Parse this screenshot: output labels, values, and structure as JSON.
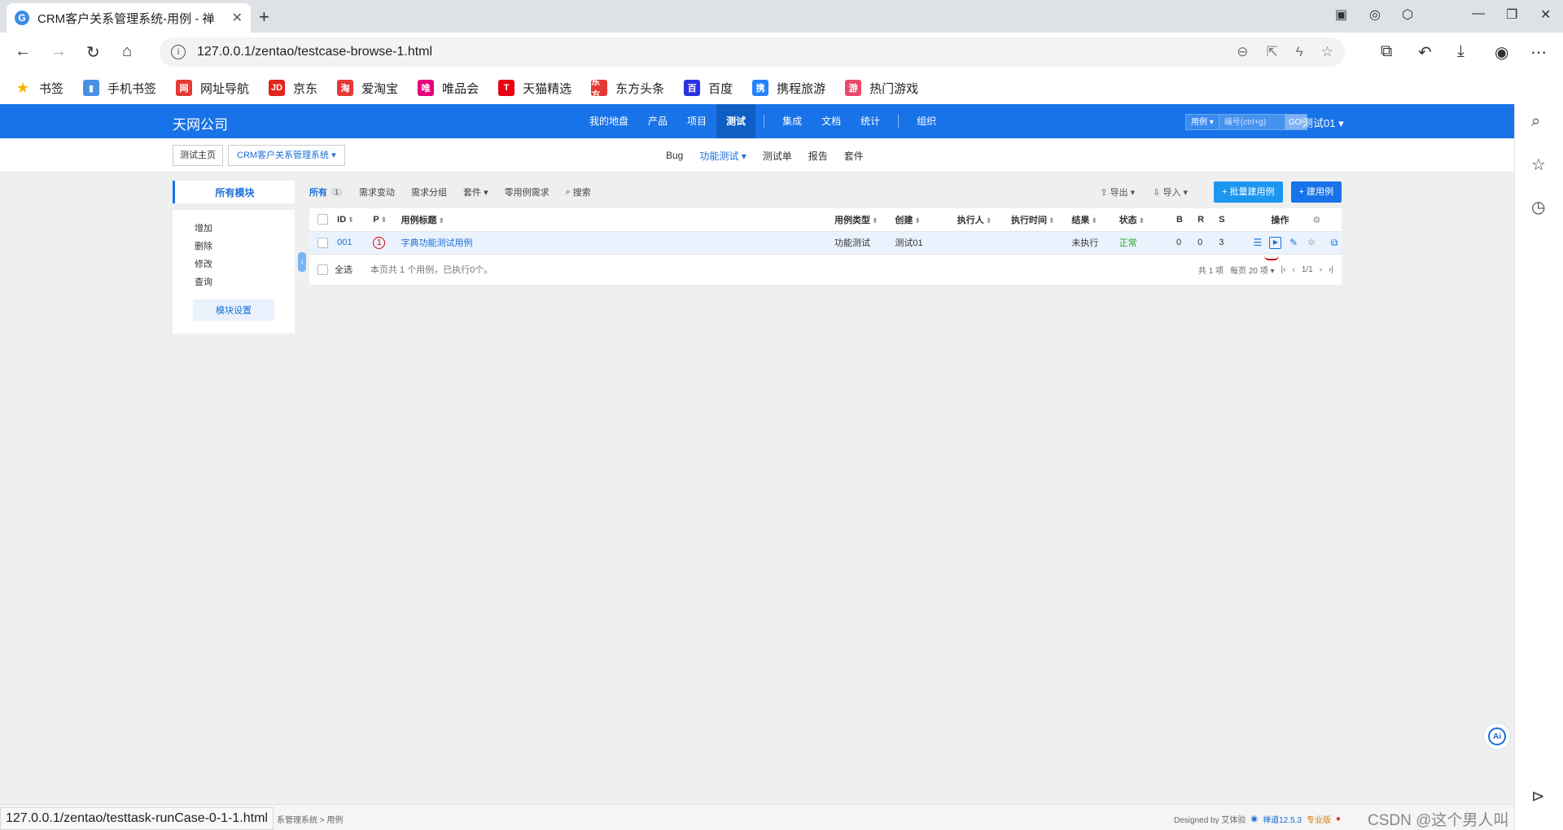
{
  "browser": {
    "tab_title": "CRM客户关系管理系统-用例 - 禅",
    "tab_close": "✕",
    "new_tab": "+",
    "url": "127.0.0.1/zentao/testcase-browse-1.html",
    "status_url": "127.0.0.1/zentao/testtask-runCase-0-1-1.html"
  },
  "bookmarks": [
    {
      "label": "书签",
      "color": "#f5b400",
      "glyph": "★"
    },
    {
      "label": "手机书签",
      "color": "#4a90e2",
      "glyph": "▮"
    },
    {
      "label": "网址导航",
      "color": "#e53935",
      "glyph": "网"
    },
    {
      "label": "京东",
      "color": "#e1251b",
      "glyph": "JD"
    },
    {
      "label": "爱淘宝",
      "color": "#e53935",
      "glyph": "淘"
    },
    {
      "label": "唯品会",
      "color": "#e5007e",
      "glyph": "唯"
    },
    {
      "label": "天猫精选",
      "color": "#e60012",
      "glyph": "T"
    },
    {
      "label": "东方头条",
      "color": "#e53935",
      "glyph": "东方"
    },
    {
      "label": "百度",
      "color": "#2932e1",
      "glyph": "百"
    },
    {
      "label": "携程旅游",
      "color": "#2681ff",
      "glyph": "携"
    },
    {
      "label": "热门游戏",
      "color": "#e94a6a",
      "glyph": "游"
    }
  ],
  "header": {
    "company": "天网公司",
    "nav": [
      "我的地盘",
      "产品",
      "项目",
      "测试",
      "集成",
      "文档",
      "统计",
      "组织"
    ],
    "active_nav": "测试",
    "search_type": "用例 ▾",
    "search_placeholder": "编号(ctrl+g)",
    "search_go": "GO!",
    "user": "测试01 ▾"
  },
  "subbar": {
    "crumb_home": "测试主页",
    "crumb_product": "CRM客户关系管理系统 ▾",
    "nav": [
      "Bug",
      "功能测试 ▾",
      "测试单",
      "报告",
      "套件"
    ]
  },
  "sidebar": {
    "title": "所有模块",
    "items": [
      "增加",
      "删除",
      "修改",
      "查询"
    ],
    "module_settings": "模块设置"
  },
  "featurebar": {
    "all": "所有",
    "all_count": "1",
    "items": [
      "需求变动",
      "需求分组",
      "套件 ▾",
      "零用例需求"
    ],
    "search": "搜索",
    "export": "导出 ▾",
    "import": "导入 ▾",
    "batch_create": "+ 批量建用例",
    "create": "+ 建用例"
  },
  "table": {
    "headers": {
      "id": "ID",
      "pri": "P",
      "title": "用例标题",
      "type": "用例类型",
      "creator": "创建",
      "executor": "执行人",
      "exec_time": "执行时间",
      "result": "结果",
      "status": "状态",
      "b": "B",
      "r": "R",
      "s": "S",
      "actions": "操作"
    },
    "row": {
      "id": "001",
      "pri": "1",
      "title": "字典功能测试用例",
      "type": "功能测试",
      "creator": "测试01",
      "executor": "",
      "exec_time": "",
      "result": "未执行",
      "status": "正常",
      "b": "0",
      "r": "0",
      "s": "3"
    },
    "select_all": "全选",
    "summary": "本页共 1 个用例，已执行0个。",
    "total": "共 1 项",
    "per_page": "每页 20 项 ▾",
    "page": "1/1"
  },
  "footer": {
    "crumb": "系管理系统 > 用例",
    "designed_by": "Designed by 艾体验",
    "version": "禅道12.5.3",
    "edition": "专业版",
    "watermark": "CSDN @这个男人叫小帅&"
  },
  "ai_label": "Ai",
  "colors": {
    "brand": "#1872e8",
    "link": "#1a6fd8",
    "active_bg": "#0f5ec4",
    "ok": "#2aa52a",
    "priority": "#dd0000"
  }
}
